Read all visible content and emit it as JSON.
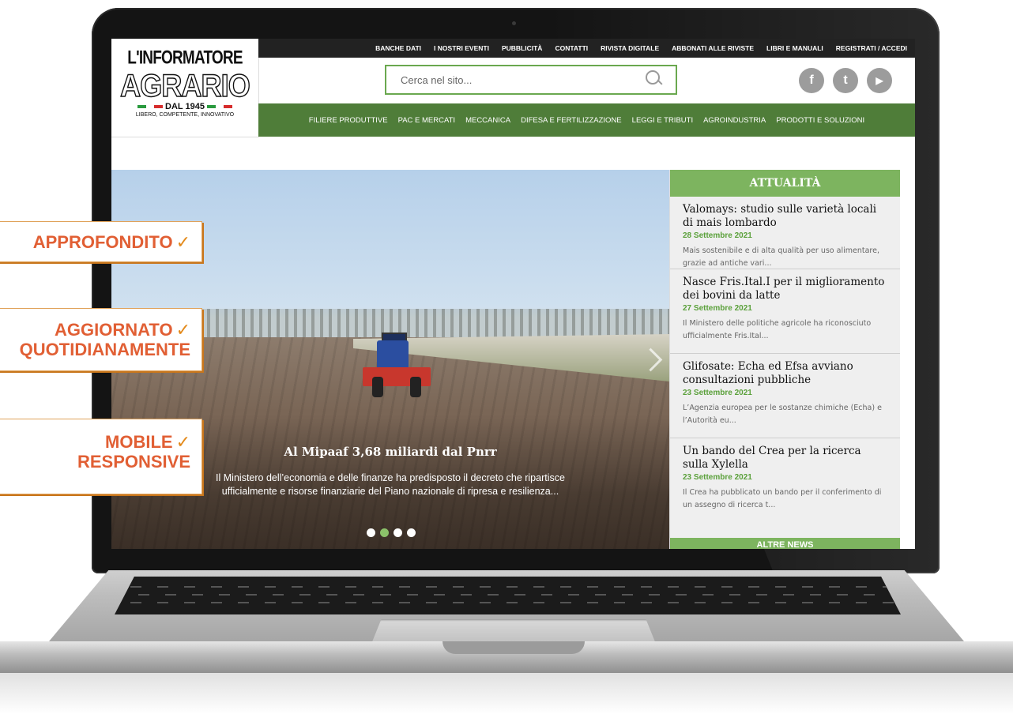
{
  "site": {
    "logo": {
      "line1": "L'INFORMATORE",
      "line2": "AGRARIO",
      "since": "DAL 1945",
      "tagline": "LIBERO, COMPETENTE, INNOVATIVO"
    },
    "topnav": [
      "BANCHE DATI",
      "I NOSTRI EVENTI",
      "PUBBLICITÀ",
      "CONTATTI",
      "RIVISTA DIGITALE",
      "ABBONATI ALLE RIVISTE",
      "LIBRI E MANUALI",
      "REGISTRATI / ACCEDI"
    ],
    "search": {
      "placeholder": "Cerca nel sito..."
    },
    "social": [
      {
        "icon": "facebook-icon",
        "glyph": "f"
      },
      {
        "icon": "twitter-icon",
        "glyph": "t"
      },
      {
        "icon": "youtube-icon",
        "glyph": "▶"
      }
    ],
    "mainnav": [
      "FILIERE PRODUTTIVE",
      "PAC E MERCATI",
      "MECCANICA",
      "DIFESA E FERTILIZZAZIONE",
      "LEGGI E TRIBUTI",
      "AGROINDUSTRIA",
      "PRODOTTI E SOLUZIONI"
    ],
    "hero": {
      "title": "Al Mipaaf 3,68 miliardi dal Pnrr",
      "text": "Il Ministero dell’economia e delle finanze ha predisposto il decreto che ripartisce ufficialmente e risorse finanziarie del Piano nazionale di ripresa e resilienza...",
      "dots": 4,
      "active_dot": 1
    },
    "news": {
      "heading": "ATTUALITÀ",
      "items": [
        {
          "title": "Valomays: studio sulle varietà locali di mais lombardo",
          "date": "28 Settembre 2021",
          "excerpt": "Mais sostenibile e di alta qualità per uso alimentare, grazie ad antiche vari..."
        },
        {
          "title": "Nasce Fris.Ital.I per il miglioramento dei bovini da latte",
          "date": "27 Settembre 2021",
          "excerpt": "Il Ministero delle politiche agricole ha riconosciuto ufficialmente Fris.Ital..."
        },
        {
          "title": "Glifosate: Echa ed Efsa avviano consultazioni pubbliche",
          "date": "23 Settembre 2021",
          "excerpt": "L’Agenzia europea per le sostanze chimiche (Echa) e l’Autorità eu..."
        },
        {
          "title": "Un bando del Crea per la ricerca sulla Xylella",
          "date": "23 Settembre 2021",
          "excerpt": "Il Crea ha pubblicato un bando per il conferimento di un assegno di ricerca t..."
        }
      ],
      "more": "ALTRE NEWS"
    }
  },
  "callouts": [
    {
      "line1": "APPROFONDITO",
      "line2": ""
    },
    {
      "line1": "AGGIORNATO",
      "line2": "QUOTIDIANAMENTE"
    },
    {
      "line1": "MOBILE",
      "line2": "RESPONSIVE"
    }
  ],
  "colors": {
    "brand_green": "#4f7d39",
    "light_green": "#7db45f",
    "callout_text": "#e15f34",
    "callout_border": "#e38a1b"
  }
}
